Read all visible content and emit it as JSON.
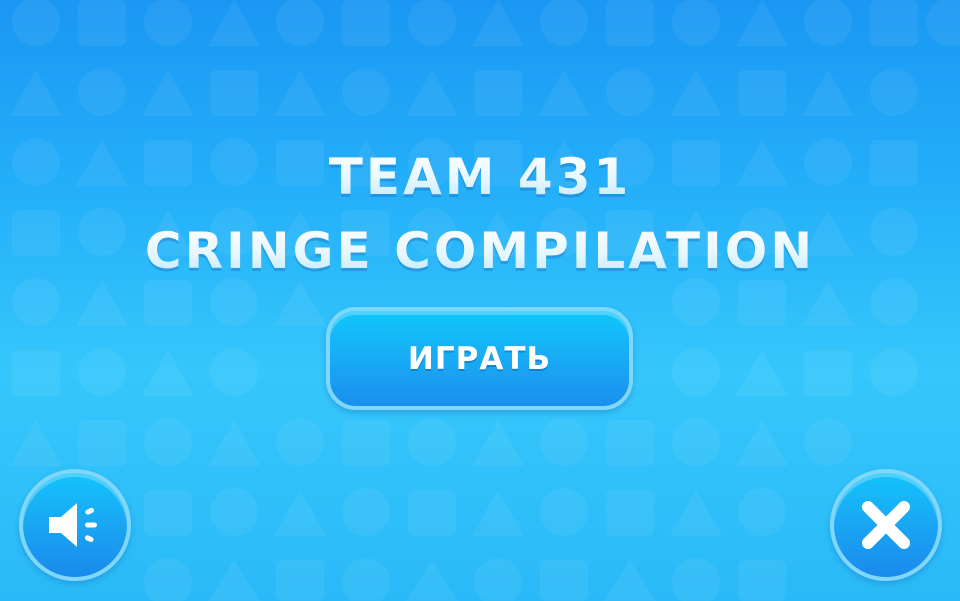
{
  "title": {
    "line1": "TEAM 431",
    "line2": "CRINGE COMPILATION"
  },
  "play_button": {
    "label": "ИГРАТЬ"
  },
  "sound_button": {
    "icon": "speaker-icon"
  },
  "close_button": {
    "icon": "close-icon"
  },
  "colors": {
    "background_top": "#1a97f3",
    "background_bottom": "#35c7fb",
    "button_fill": "#18aef5",
    "button_border": "#7fd8fb",
    "text": "#ffffff"
  }
}
